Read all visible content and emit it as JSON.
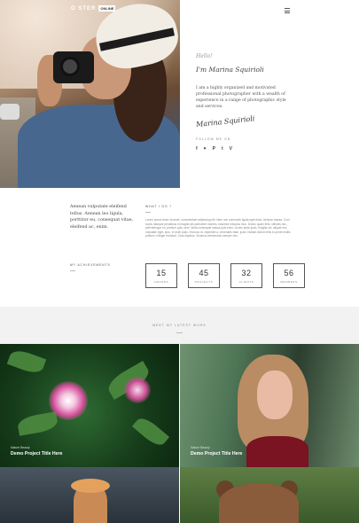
{
  "brand": {
    "logo_text": "O  STER",
    "logo_badge": "ONLINE"
  },
  "intro": {
    "hello": "Hello!",
    "name": "I'm Marina Squirioli",
    "bio": "I am a highly organized and motivated professional photographer with a wealth of experience in a range of photographic style and services.",
    "signature": "Marina Squirioli",
    "follow_label": "FOLLOW ME ON",
    "socials": [
      "f",
      "♥",
      "P",
      "t",
      "V"
    ]
  },
  "about": {
    "text": "Aenean vulputate eleifend tellus. Aenean leo ligula, porttitor eu, consequat vitae, eleifend ac, enim."
  },
  "what_i_do": {
    "label": "WHAT I DO ?",
    "text": "Lorem ipsum dolor sit amet, consectetuer adipiscing elit. Nam non commodo ligula eget dolor. Aenean massa. Cum sociis natoque penatibus et magnis dis parturient montes, nascetur ridiculus mus. Donec quam felis, ultricies nec, pellentesque eu, pretium quis, sem. Nulla consequat massa quis enim. Donec pede justo, fringilla vel, aliquet nec, vulputate eget, arcu. In enim justo, rhoncus ut, imperdiet a, venenatis vitae, justo. Nullam dictum felis eu pede mollis pretium. Integer tincidunt. Cras dapibus. Vivamus elementum semper nisi."
  },
  "achievements": {
    "label": "MY ACHIEVEMENTS",
    "stats": [
      {
        "value": "15",
        "label": "AWARDS"
      },
      {
        "value": "45",
        "label": "PROJECTS"
      },
      {
        "value": "32",
        "label": "CLIENTS"
      },
      {
        "value": "56",
        "label": "MEMBERS"
      }
    ]
  },
  "work": {
    "title": "MEET MY LATEST WORK",
    "items": [
      {
        "category": "Nature Beauty",
        "title": "Demo Project Title Here"
      },
      {
        "category": "Nature Beauty",
        "title": "Demo Project Title Here"
      }
    ]
  }
}
